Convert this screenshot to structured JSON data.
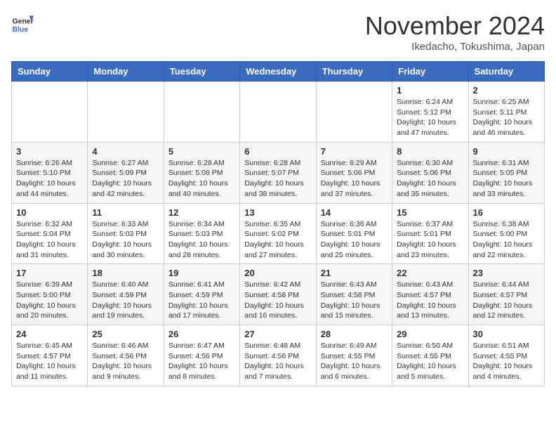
{
  "header": {
    "logo_line1": "General",
    "logo_line2": "Blue",
    "month_title": "November 2024",
    "location": "Ikedacho, Tokushima, Japan"
  },
  "weekdays": [
    "Sunday",
    "Monday",
    "Tuesday",
    "Wednesday",
    "Thursday",
    "Friday",
    "Saturday"
  ],
  "weeks": [
    [
      {
        "day": "",
        "info": ""
      },
      {
        "day": "",
        "info": ""
      },
      {
        "day": "",
        "info": ""
      },
      {
        "day": "",
        "info": ""
      },
      {
        "day": "",
        "info": ""
      },
      {
        "day": "1",
        "info": "Sunrise: 6:24 AM\nSunset: 5:12 PM\nDaylight: 10 hours and 47 minutes."
      },
      {
        "day": "2",
        "info": "Sunrise: 6:25 AM\nSunset: 5:11 PM\nDaylight: 10 hours and 46 minutes."
      }
    ],
    [
      {
        "day": "3",
        "info": "Sunrise: 6:26 AM\nSunset: 5:10 PM\nDaylight: 10 hours and 44 minutes."
      },
      {
        "day": "4",
        "info": "Sunrise: 6:27 AM\nSunset: 5:09 PM\nDaylight: 10 hours and 42 minutes."
      },
      {
        "day": "5",
        "info": "Sunrise: 6:28 AM\nSunset: 5:08 PM\nDaylight: 10 hours and 40 minutes."
      },
      {
        "day": "6",
        "info": "Sunrise: 6:28 AM\nSunset: 5:07 PM\nDaylight: 10 hours and 38 minutes."
      },
      {
        "day": "7",
        "info": "Sunrise: 6:29 AM\nSunset: 5:06 PM\nDaylight: 10 hours and 37 minutes."
      },
      {
        "day": "8",
        "info": "Sunrise: 6:30 AM\nSunset: 5:06 PM\nDaylight: 10 hours and 35 minutes."
      },
      {
        "day": "9",
        "info": "Sunrise: 6:31 AM\nSunset: 5:05 PM\nDaylight: 10 hours and 33 minutes."
      }
    ],
    [
      {
        "day": "10",
        "info": "Sunrise: 6:32 AM\nSunset: 5:04 PM\nDaylight: 10 hours and 31 minutes."
      },
      {
        "day": "11",
        "info": "Sunrise: 6:33 AM\nSunset: 5:03 PM\nDaylight: 10 hours and 30 minutes."
      },
      {
        "day": "12",
        "info": "Sunrise: 6:34 AM\nSunset: 5:03 PM\nDaylight: 10 hours and 28 minutes."
      },
      {
        "day": "13",
        "info": "Sunrise: 6:35 AM\nSunset: 5:02 PM\nDaylight: 10 hours and 27 minutes."
      },
      {
        "day": "14",
        "info": "Sunrise: 6:36 AM\nSunset: 5:01 PM\nDaylight: 10 hours and 25 minutes."
      },
      {
        "day": "15",
        "info": "Sunrise: 6:37 AM\nSunset: 5:01 PM\nDaylight: 10 hours and 23 minutes."
      },
      {
        "day": "16",
        "info": "Sunrise: 6:38 AM\nSunset: 5:00 PM\nDaylight: 10 hours and 22 minutes."
      }
    ],
    [
      {
        "day": "17",
        "info": "Sunrise: 6:39 AM\nSunset: 5:00 PM\nDaylight: 10 hours and 20 minutes."
      },
      {
        "day": "18",
        "info": "Sunrise: 6:40 AM\nSunset: 4:59 PM\nDaylight: 10 hours and 19 minutes."
      },
      {
        "day": "19",
        "info": "Sunrise: 6:41 AM\nSunset: 4:59 PM\nDaylight: 10 hours and 17 minutes."
      },
      {
        "day": "20",
        "info": "Sunrise: 6:42 AM\nSunset: 4:58 PM\nDaylight: 10 hours and 16 minutes."
      },
      {
        "day": "21",
        "info": "Sunrise: 6:43 AM\nSunset: 4:58 PM\nDaylight: 10 hours and 15 minutes."
      },
      {
        "day": "22",
        "info": "Sunrise: 6:43 AM\nSunset: 4:57 PM\nDaylight: 10 hours and 13 minutes."
      },
      {
        "day": "23",
        "info": "Sunrise: 6:44 AM\nSunset: 4:57 PM\nDaylight: 10 hours and 12 minutes."
      }
    ],
    [
      {
        "day": "24",
        "info": "Sunrise: 6:45 AM\nSunset: 4:57 PM\nDaylight: 10 hours and 11 minutes."
      },
      {
        "day": "25",
        "info": "Sunrise: 6:46 AM\nSunset: 4:56 PM\nDaylight: 10 hours and 9 minutes."
      },
      {
        "day": "26",
        "info": "Sunrise: 6:47 AM\nSunset: 4:56 PM\nDaylight: 10 hours and 8 minutes."
      },
      {
        "day": "27",
        "info": "Sunrise: 6:48 AM\nSunset: 4:56 PM\nDaylight: 10 hours and 7 minutes."
      },
      {
        "day": "28",
        "info": "Sunrise: 6:49 AM\nSunset: 4:55 PM\nDaylight: 10 hours and 6 minutes."
      },
      {
        "day": "29",
        "info": "Sunrise: 6:50 AM\nSunset: 4:55 PM\nDaylight: 10 hours and 5 minutes."
      },
      {
        "day": "30",
        "info": "Sunrise: 6:51 AM\nSunset: 4:55 PM\nDaylight: 10 hours and 4 minutes."
      }
    ]
  ]
}
